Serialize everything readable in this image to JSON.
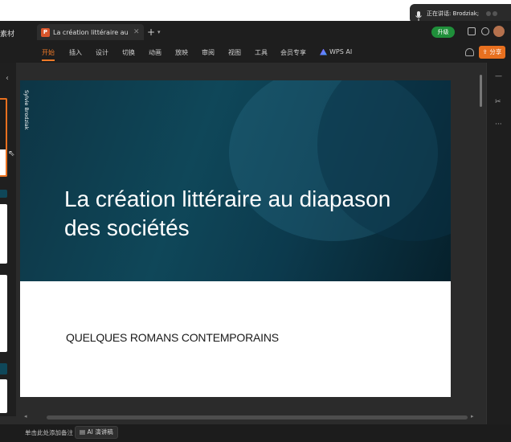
{
  "top_banner": {
    "speaking_label": "正在讲话:  Brodziak;"
  },
  "tabbar": {
    "left_tab_label": "素材",
    "doc_tab_title": "La création littéraire au d",
    "doc_tab_icon": "P",
    "upgrade_label": "升级"
  },
  "menu": {
    "items": [
      "开始",
      "插入",
      "设计",
      "切换",
      "动画",
      "放映",
      "审阅",
      "视图",
      "工具",
      "会员专享"
    ],
    "active": "开始",
    "wps_ai_label": "WPS AI",
    "share_label": "分享"
  },
  "slide": {
    "author_vertical": "Sylvie Brodziak",
    "title_line1": "La création littéraire au diapason",
    "title_line2": "des sociétés",
    "subtitle": "QUELQUES ROMANS CONTEMPORAINS",
    "accent_color": "#0f4759"
  },
  "bottom": {
    "notes_placeholder": "单击此处添加备注",
    "ai_notes_label": "AI 演讲稿"
  },
  "colors": {
    "accent_orange": "#e8701f",
    "upgrade_green": "#1f8f3a"
  }
}
